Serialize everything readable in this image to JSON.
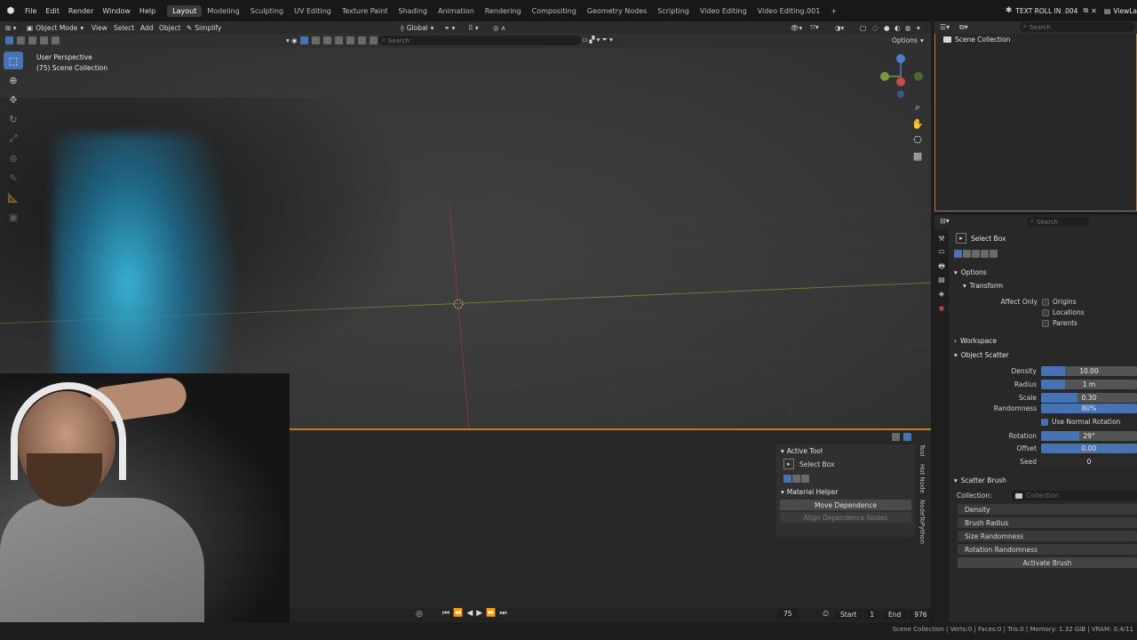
{
  "app": {
    "menu": [
      "File",
      "Edit",
      "Render",
      "Window",
      "Help"
    ],
    "workspaces": [
      "Layout",
      "Modeling",
      "Sculpting",
      "UV Editing",
      "Texture Paint",
      "Shading",
      "Animation",
      "Rendering",
      "Compositing",
      "Geometry Nodes",
      "Scripting",
      "Video Editing",
      "Video Editing.001"
    ],
    "active_workspace": "Layout",
    "add_workspace": "+",
    "scene_name": "TEXT ROLL IN .004",
    "view_layer": "ViewLa"
  },
  "viewport": {
    "mode": "Object Mode",
    "menu": [
      "View",
      "Select",
      "Add",
      "Object"
    ],
    "simplify": "Simplify",
    "orientation": "Global",
    "search_placeholder": "Search",
    "options": "Options",
    "overlay_title": "User Perspective",
    "overlay_collection": "(75) Scene Collection"
  },
  "npanel": {
    "active_tool_title": "Active Tool",
    "active_tool_name": "Select Box",
    "material_helper_title": "Material Helper",
    "move_dependence": "Move Dependence",
    "align_dependence": "Align Dependence Nodes",
    "tabs": [
      "Tool",
      "Hot Node",
      "NodeToPython"
    ]
  },
  "timeline": {
    "current_frame": "75",
    "start_label": "Start",
    "start_value": "1",
    "end_label": "End",
    "end_value": "976"
  },
  "outliner": {
    "search_placeholder": "Search",
    "root": "Scene Collection"
  },
  "properties": {
    "search_placeholder": "Search",
    "tool_name": "Select Box",
    "options_header": "Options",
    "transform_header": "Transform",
    "affect_only_label": "Affect Only",
    "affect_origins": "Origins",
    "affect_locations": "Locations",
    "affect_parents": "Parents",
    "workspace_header": "Workspace",
    "object_scatter_header": "Object Scatter",
    "density_label": "Density",
    "density_value": "10.00",
    "density_fill": 0.25,
    "radius_label": "Radius",
    "radius_value": "1 m",
    "radius_fill": 0.25,
    "scale_label": "Scale",
    "scale_value": "0.30",
    "scale_fill": 0.38,
    "randomness_label": "Randomness",
    "randomness_value": "80%",
    "randomness_fill": 1.0,
    "use_normal_rotation": "Use Normal Rotation",
    "rotation_label": "Rotation",
    "rotation_value": "29°",
    "rotation_fill": 0.4,
    "offset_label": "Offset",
    "offset_value": "0.00",
    "offset_fill": 1.0,
    "seed_label": "Seed",
    "seed_value": "0",
    "scatter_brush_header": "Scatter Brush",
    "collection_label": "Collection:",
    "collection_placeholder": "Collection",
    "brush_density": "Density",
    "brush_radius": "Brush Radius",
    "size_randomness": "Size Randomness",
    "rotation_randomness": "Rotation Randomness",
    "activate_brush": "Activate Brush"
  },
  "status": {
    "text": "Scene Collection | Verts:0 | Faces:0 | Tris:0 | Memory: 1.32 GiB | VRAM: 0.4/11"
  },
  "colors": {
    "accent": "#4772b3",
    "active_outline": "#c67a25"
  }
}
